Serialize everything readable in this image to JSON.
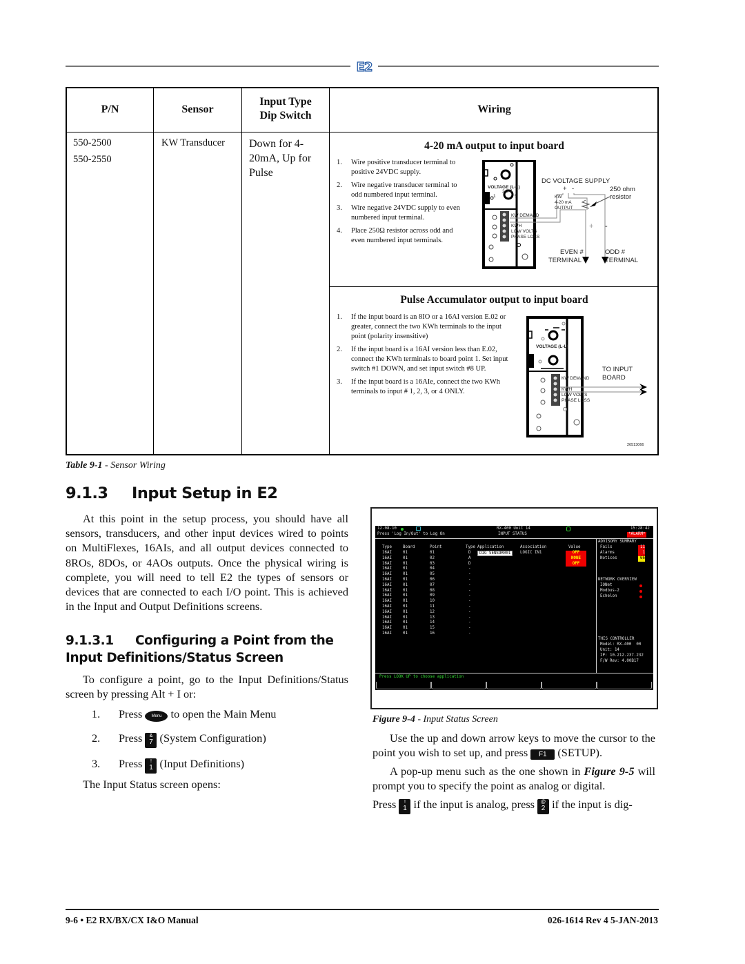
{
  "header": {
    "logo_text": "E2"
  },
  "table": {
    "headers": {
      "pn": "P/N",
      "sensor": "Sensor",
      "input_type_line1": "Input Type",
      "input_type_line2": "Dip Switch",
      "wiring": "Wiring"
    },
    "row": {
      "part_numbers": [
        "550-2500",
        "550-2550"
      ],
      "sensor": "KW Transducer",
      "dip_switch": [
        "Down for 4-",
        "20mA, Up for",
        "Pulse"
      ]
    },
    "section_420": {
      "title": "4-20 mA output to input board",
      "steps": [
        {
          "num": "1.",
          "text": "Wire positive transducer terminal to positive 24VDC supply."
        },
        {
          "num": "2.",
          "text": "Wire negative transducer terminal to odd numbered input terminal."
        },
        {
          "num": "3.",
          "text": "Wire negative 24VDC supply to even numbered input terminal."
        },
        {
          "num": "4.",
          "text": "Place 250Ω resistor across odd and even numbered input terminals."
        }
      ],
      "diagram": {
        "dc_supply": "DC VOLTAGE SUPPLY",
        "plus": "+",
        "minus": "-",
        "resistor_line1": "250 ohm",
        "resistor_line2": "resistor",
        "kw": "KW",
        "kw_420": "4-20 mA",
        "output": "OUTPUT",
        "voltage_label": "VOLTAGE (L-L)",
        "dial_numbers": "2 3 4",
        "dial_1": "1",
        "dial_5": "5",
        "kw_demand": "KW DEMAND",
        "kwh": "KWH",
        "low_volts": "LOW VOLTS",
        "phase_loss": "PHASE LOSS",
        "even_line1": "EVEN #",
        "even_line2": "TERMINAL",
        "odd_line1": "ODD #",
        "odd_line2": "TERMINAL"
      }
    },
    "section_pulse": {
      "title": "Pulse Accumulator output to input board",
      "steps": [
        {
          "num": "1.",
          "text": "If the input board is an 8IO or a 16AI version E.02 or greater, connect the two KWh terminals to the input point (polarity insensitive)"
        },
        {
          "num": "2.",
          "text": "If the input board is a 16AI version less than E.02, connect the KWh terminals to board point 1. Set input switch #1 DOWN, and set input switch #8 UP."
        },
        {
          "num": "3.",
          "text": "If the input board is a 16AIe, connect the two KWh terminals to input # 1, 2, 3, or 4 ONLY."
        }
      ],
      "diagram": {
        "voltage_label": "VOLTAGE (L-L)",
        "kw_demand": "KW DEMAND",
        "kwh": "KWH",
        "low_volts": "LOW VOLTS",
        "phase_loss": "PHASE LOSS",
        "to_input_line1": "TO INPUT",
        "to_input_line2": "BOARD",
        "drawing_id": "26513066"
      }
    }
  },
  "table_caption": {
    "label": "Table 9-1",
    "text": " - Sensor Wiring"
  },
  "section": {
    "num": "9.1.3",
    "title": "Input Setup in E2",
    "intro": "At this point in the setup process, you should have all sensors, transducers, and other input devices wired to points on MultiFlexes, 16AIs, and all output devices connected to 8ROs, 8DOs, or 4AOs outputs. Once the physical wiring is complete, you will need to tell E2 the types of sensors or devices that are connected to each I/O point. This is achieved in the Input and Output Definitions screens."
  },
  "subsection": {
    "num": "9.1.3.1",
    "title_line1": "Configuring a Point from the",
    "title_line2": "Input Definitions/Status Screen",
    "intro": "To configure a point, go to the Input Definitions/Status screen by pressing Alt + I or:",
    "steps": [
      {
        "num": "1.",
        "pre": "Press",
        "key": "Menu",
        "post": "to open the Main Menu"
      },
      {
        "num": "2.",
        "pre": "Press",
        "key_top": "&",
        "key": "7",
        "post": "(System Configuration)"
      },
      {
        "num": "3.",
        "pre": "Press",
        "key_top": "!",
        "key": "1",
        "post": "(Input Definitions)"
      }
    ],
    "outro": "The Input Status screen opens:"
  },
  "screen": {
    "date": "12-08-10",
    "controller": "RX-400 Unit 14",
    "time": "15:28:42",
    "login_hint": "Press 'Log In/Out' to Log On",
    "screen_title": "INPUT STATUS",
    "alarm_badge": "*ALARM*",
    "columns": [
      "Type",
      "Board",
      "Point",
      "Type",
      "Application",
      "Association",
      "Value"
    ],
    "rows": [
      {
        "type": "16AI",
        "board": "01",
        "point": "01",
        "ptype": "D",
        "application": "DIG SENSOR001",
        "association": "LOGIC IN1",
        "value": "OFF"
      },
      {
        "type": "16AI",
        "board": "01",
        "point": "02",
        "ptype": "A",
        "application": "",
        "association": "",
        "value": "NONE"
      },
      {
        "type": "16AI",
        "board": "01",
        "point": "03",
        "ptype": "D",
        "application": "",
        "association": "",
        "value": "OFF"
      },
      {
        "type": "16AI",
        "board": "01",
        "point": "04",
        "ptype": "-",
        "application": "",
        "association": "",
        "value": ""
      },
      {
        "type": "16AI",
        "board": "01",
        "point": "05",
        "ptype": "-",
        "application": "",
        "association": "",
        "value": ""
      },
      {
        "type": "16AI",
        "board": "01",
        "point": "06",
        "ptype": "-",
        "application": "",
        "association": "",
        "value": ""
      },
      {
        "type": "16AI",
        "board": "01",
        "point": "07",
        "ptype": "-",
        "application": "",
        "association": "",
        "value": ""
      },
      {
        "type": "16AI",
        "board": "01",
        "point": "08",
        "ptype": "-",
        "application": "",
        "association": "",
        "value": ""
      },
      {
        "type": "16AI",
        "board": "01",
        "point": "09",
        "ptype": "-",
        "application": "",
        "association": "",
        "value": ""
      },
      {
        "type": "16AI",
        "board": "01",
        "point": "10",
        "ptype": "-",
        "application": "",
        "association": "",
        "value": ""
      },
      {
        "type": "16AI",
        "board": "01",
        "point": "11",
        "ptype": "-",
        "application": "",
        "association": "",
        "value": ""
      },
      {
        "type": "16AI",
        "board": "01",
        "point": "12",
        "ptype": "-",
        "application": "",
        "association": "",
        "value": ""
      },
      {
        "type": "16AI",
        "board": "01",
        "point": "13",
        "ptype": "-",
        "application": "",
        "association": "",
        "value": ""
      },
      {
        "type": "16AI",
        "board": "01",
        "point": "14",
        "ptype": "-",
        "application": "",
        "association": "",
        "value": ""
      },
      {
        "type": "16AI",
        "board": "01",
        "point": "15",
        "ptype": "-",
        "application": "",
        "association": "",
        "value": ""
      },
      {
        "type": "16AI",
        "board": "01",
        "point": "16",
        "ptype": "-",
        "application": "",
        "association": "",
        "value": ""
      }
    ],
    "advisory": {
      "title": "ADVISORY SUMMARY",
      "items": [
        {
          "label": "Fails",
          "value": "11",
          "color": "#e00000"
        },
        {
          "label": "Alarms",
          "value": "1",
          "color": "#e00000"
        },
        {
          "label": "Notices",
          "value": "66",
          "color": "#f2e600"
        }
      ]
    },
    "network": {
      "title": "NETWORK OVERVIEW",
      "items": [
        "IONet",
        "Modbus-2",
        "Echelon"
      ]
    },
    "controller_info": {
      "title": "THIS CONTROLLER",
      "model": "Model: RX-400  00",
      "unit": "Unit: 14",
      "ip": "IP: 10.212.237.232",
      "fw": "F/W Rev: 4.00B17"
    },
    "status_bar": "Press LOOK UP to choose application",
    "colors": {
      "status_green": "#33dd33",
      "alarm_red": "#e00000",
      "header_cyan": "#3ab0c0"
    }
  },
  "figure_caption": {
    "label": "Figure 9-4",
    "text": " - Input Status Screen"
  },
  "right_text": {
    "p1_pre": "Use the up and down arrow keys to move the cursor to the point you wish to set up, and press",
    "p1_key": "F1",
    "p1_post": "(SETUP).",
    "p2_pre": "A pop-up menu such as the one shown in",
    "p2_ref": "Figure 9-5",
    "p2_post": "will prompt you to specify the point as analog or digital.",
    "p3_press": "Press",
    "p3_key1_top": "!",
    "p3_key1": "1",
    "p3_mid": "if the input is analog, press",
    "p3_key2_top": "@",
    "p3_key2": "2",
    "p3_post": "if the input is dig-"
  },
  "footer": {
    "left": "9-6 • E2 RX/BX/CX I&O Manual",
    "right": "026-1614 Rev 4 5-JAN-2013"
  }
}
